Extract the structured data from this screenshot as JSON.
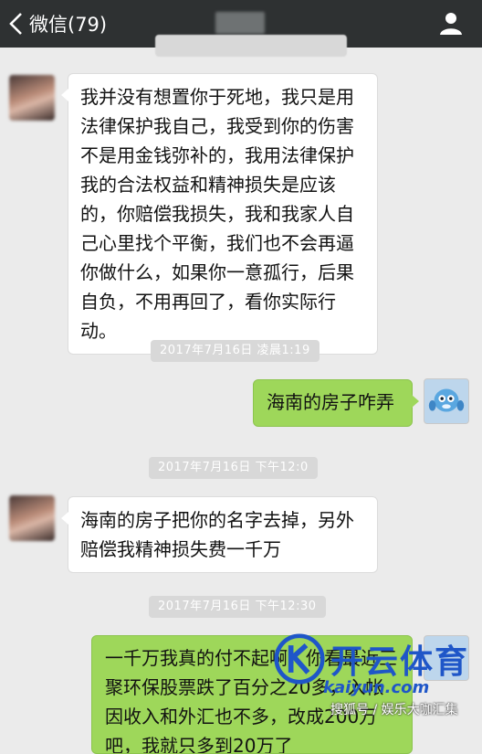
{
  "topbar": {
    "back_label": "微信(79)",
    "title": ""
  },
  "timestamps": {
    "t0": "",
    "t1": "2017年7月16日 凌晨1:19",
    "t2": "2017年7月16日 下午12:0",
    "t3": "2017年7月16日 下午12:30"
  },
  "messages": {
    "m1": "我并没有想置你于死地，我只是用法律保护我自己，我受到你的伤害不是用金钱弥补的，我用法律保护我的合法权益和精神损失是应该的，你赔偿我损失，我和我家人自己心里找个平衡，我们也不会再逼你做什么，如果你一意孤行，后果自负，不用再回了，看你实际行动。",
    "m2": "海南的房子咋弄",
    "m3": "海南的房子把你的名字去掉，另外赔偿我精神损失费一千万",
    "m4": "一千万我真的付不起啊，你看最近三聚环保股票跌了百分之20多，入帐因收入和外汇也不多，改成200万吧，我就只多到20万了"
  },
  "watermark": {
    "brand": "开云体育",
    "url": "kaiyun.com",
    "caption": "搜狐号 / 娱乐大咖汇集"
  },
  "colors": {
    "topbar": "#2e3132",
    "bubble_right": "#9ed75a",
    "bubble_left": "#ffffff",
    "background": "#ebebeb",
    "watermark": "#1f56c8"
  }
}
